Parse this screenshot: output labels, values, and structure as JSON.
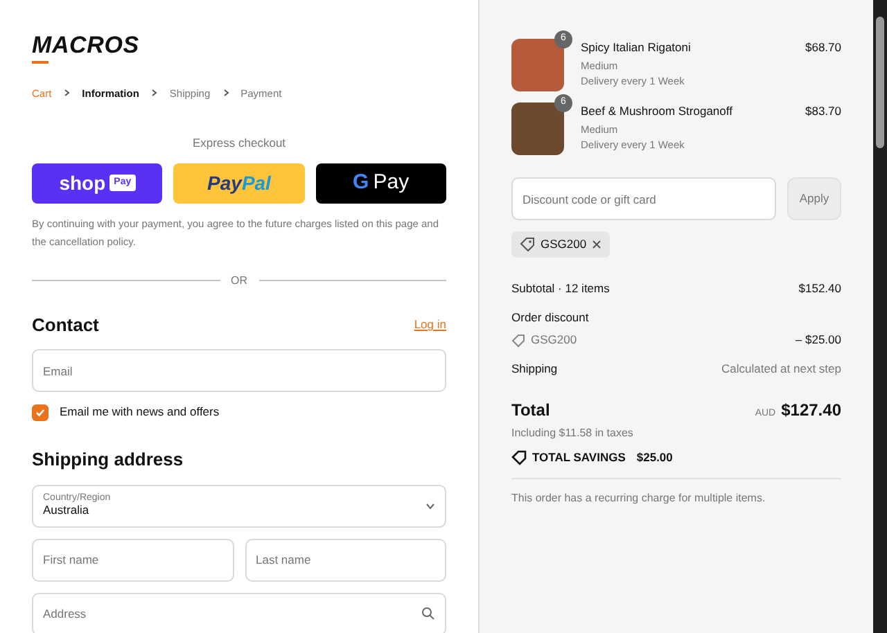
{
  "logo": {
    "text": "MACROS"
  },
  "breadcrumbs": [
    {
      "label": "Cart",
      "kind": "link"
    },
    {
      "label": "Information",
      "kind": "current"
    },
    {
      "label": "Shipping",
      "kind": "step"
    },
    {
      "label": "Payment",
      "kind": "step"
    }
  ],
  "express_checkout": {
    "label": "Express checkout",
    "buttons": [
      {
        "kind": "shop",
        "parts": [
          "shop",
          "Pay"
        ]
      },
      {
        "kind": "paypal",
        "parts": [
          "Pay",
          "Pal"
        ]
      },
      {
        "kind": "gpay",
        "parts": [
          "G",
          "Pay"
        ]
      }
    ],
    "disclaimer": "By continuing with your payment, you agree to the future charges listed on this page and the cancellation policy.",
    "divider": "OR"
  },
  "contact": {
    "title": "Contact",
    "login": "Log in",
    "email": {
      "placeholder": "Email"
    },
    "newsletter": {
      "label": "Email me with news and offers",
      "checked": true
    }
  },
  "shipping_address": {
    "title": "Shipping address",
    "country": {
      "label": "Country/Region",
      "value": "Australia"
    },
    "first_name": {
      "placeholder": "First name"
    },
    "last_name": {
      "placeholder": "Last name"
    },
    "address": {
      "placeholder": "Address"
    }
  },
  "order": {
    "items": [
      {
        "name": "Spicy Italian Rigatoni",
        "variant": "Medium",
        "delivery": "Delivery every 1 Week",
        "quantity": "6",
        "price": "$68.70"
      },
      {
        "name": "Beef & Mushroom Stroganoff",
        "variant": "Medium",
        "delivery": "Delivery every 1 Week",
        "quantity": "6",
        "price": "$83.70"
      }
    ],
    "discount": {
      "placeholder": "Discount code or gift card",
      "button": "Apply",
      "applied_code": "GSG200"
    },
    "subtotal": {
      "label": "Subtotal · 12 items",
      "value": "$152.40"
    },
    "order_discount": {
      "label": "Order discount",
      "code": "GSG200",
      "value": "– $25.00"
    },
    "shipping": {
      "label": "Shipping",
      "value": "Calculated at next step"
    },
    "total": {
      "label": "Total",
      "currency": "AUD",
      "value": "$127.40",
      "taxes": "Including $11.58 in taxes"
    },
    "savings": {
      "label": "TOTAL SAVINGS",
      "value": "$25.00"
    },
    "note": "This order has a recurring charge for multiple items."
  }
}
